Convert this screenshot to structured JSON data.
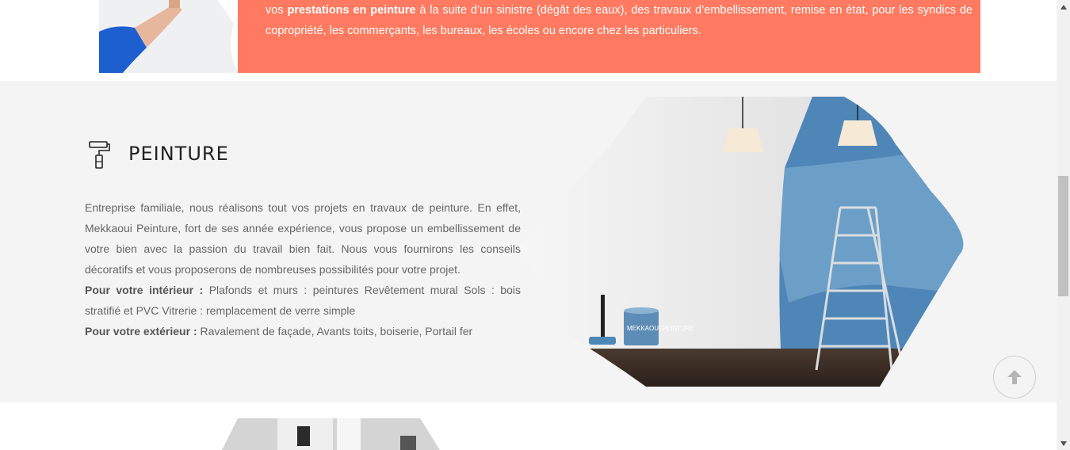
{
  "banner": {
    "text_pre": "vos ",
    "text_bold": "prestations en peinture",
    "text_post": " à la suite d’un sinistre (dégât des eaux), des travaux d’embellissement, remise en état, pour les syndics de copropriété, les commerçants, les bureaux, les écoles ou encore chez les particuliers."
  },
  "section": {
    "icon": "paint-roller-icon",
    "title": "PEINTURE",
    "paragraph": "Entreprise familiale, nous réalisons tout vos projets en travaux de peinture. En effet, Mekkaoui Peinture, fort de ses année expérience, vous propose un embellissement de votre bien avec la passion du travail bien fait. Nous vous fournirons les conseils décoratifs et vous proposerons de nombreuses possibilités pour votre projet.",
    "interior_label": "Pour votre intérieur :",
    "interior_text": " Plafonds et murs : peintures Revêtement mural Sols : bois stratifié et PVC Vitrerie : remplacement de verre simple",
    "exterior_label": "Pour votre extérieur :",
    "exterior_text": " Ravalement de façade, Avants toits, boiserie, Portail fer",
    "image_caption": "MEKKAOUI PEINTURE"
  },
  "scroll_top": {
    "icon": "arrow-up-icon"
  },
  "colors": {
    "coral": "#ff7a60",
    "grey_bg": "#f4f4f4",
    "blue_wall": "#4f86b8"
  }
}
